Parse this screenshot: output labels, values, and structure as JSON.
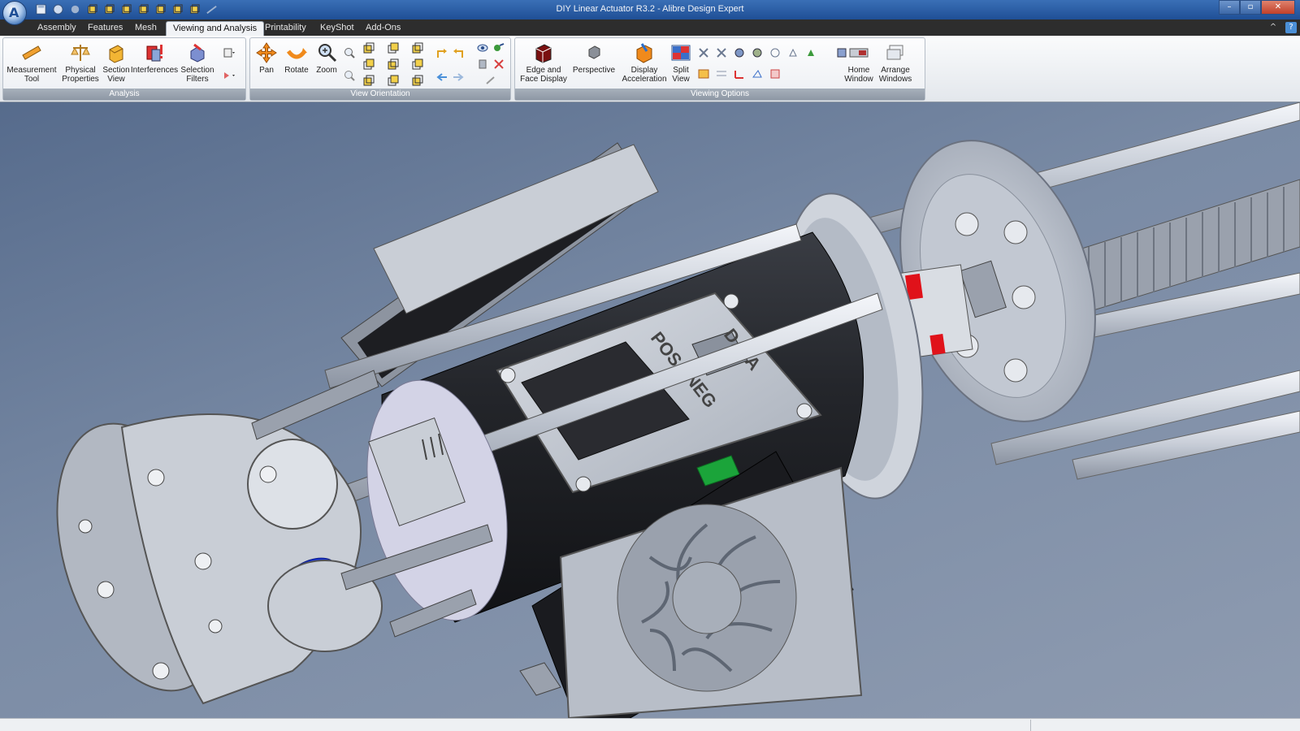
{
  "window": {
    "title": "DIY Linear Actuator R3.2 - Alibre Design Expert"
  },
  "tabs": [
    "Assembly",
    "Features",
    "Mesh",
    "Viewing and Analysis",
    "Printability",
    "KeyShot",
    "Add-Ons"
  ],
  "active_tab": "Viewing and Analysis",
  "ribbon": {
    "analysis": {
      "label": "Analysis",
      "measurement": [
        "Measurement",
        "Tool"
      ],
      "physical": [
        "Physical",
        "Properties"
      ],
      "section": [
        "Section",
        "View"
      ],
      "interferences": "Interferences",
      "selection": [
        "Selection",
        "Filters"
      ]
    },
    "orientation": {
      "label": "View Orientation",
      "pan": "Pan",
      "rotate": "Rotate",
      "zoom": "Zoom"
    },
    "viewing": {
      "label": "Viewing Options",
      "edge": [
        "Edge and",
        "Face Display"
      ],
      "perspective": "Perspective",
      "display": [
        "Display",
        "Acceleration"
      ],
      "split": [
        "Split",
        "View"
      ],
      "home": [
        "Home",
        "Window"
      ],
      "arrange": [
        "Arrange",
        "Windows"
      ]
    }
  },
  "model_labels": {
    "data": "DATA",
    "pos": "POS",
    "neg": "NEG"
  },
  "colors": {
    "title_bar": "#2b5ea6",
    "tab_bar": "#2d2d2d",
    "viewport_bg": "#6d7d95",
    "part_grey": "#c9ced6",
    "housing_dark": "#1d1e22",
    "accent_red": "#e0121a",
    "accent_blue": "#1430d8",
    "accent_green": "#1ba43a"
  }
}
